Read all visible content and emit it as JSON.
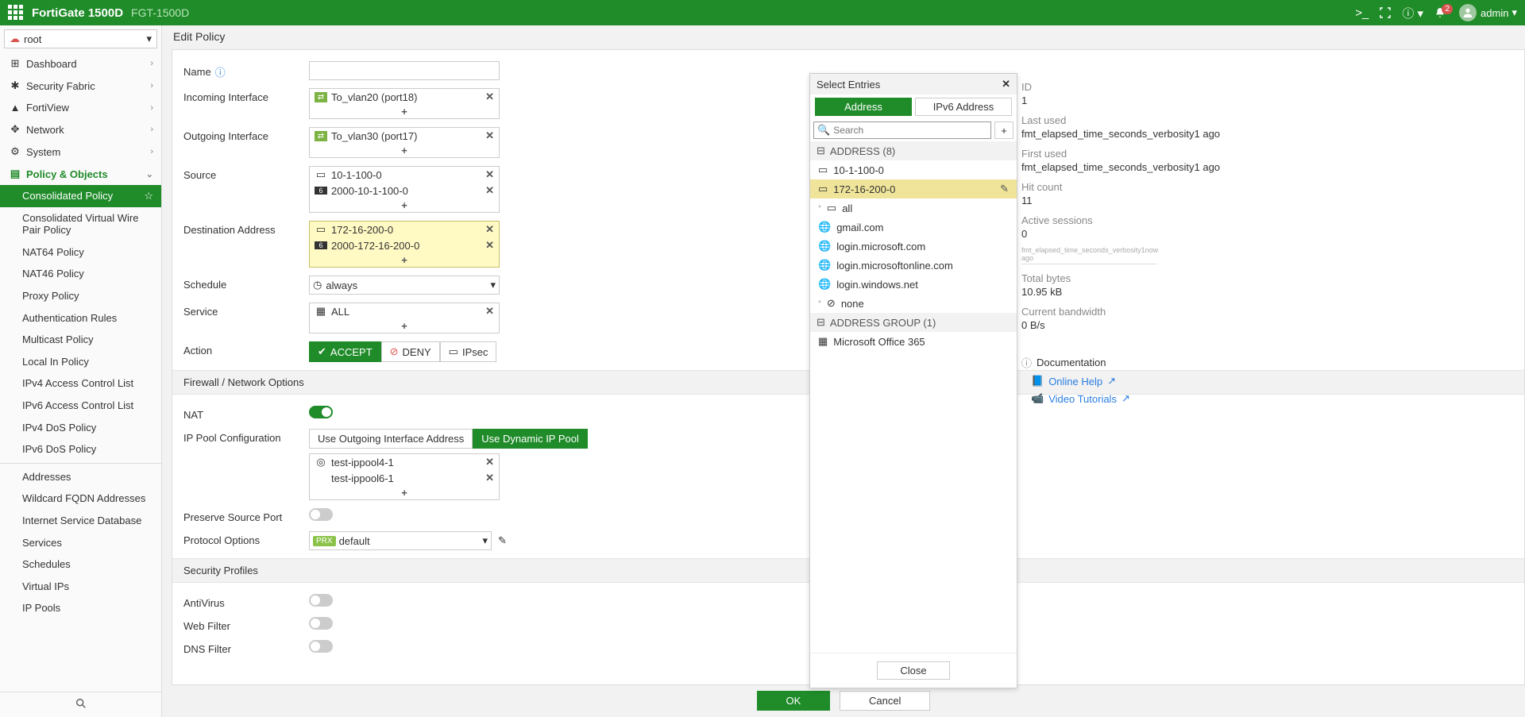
{
  "header": {
    "product": "FortiGate 1500D",
    "model": "FGT-1500D",
    "notification_count": "2",
    "admin": "admin"
  },
  "sidebar": {
    "vdom": "root",
    "items": [
      {
        "icon": "dashboard",
        "label": "Dashboard",
        "arrow": true
      },
      {
        "icon": "security-fabric",
        "label": "Security Fabric",
        "arrow": true
      },
      {
        "icon": "fortiview",
        "label": "FortiView",
        "arrow": true
      },
      {
        "icon": "network",
        "label": "Network",
        "arrow": true
      },
      {
        "icon": "system",
        "label": "System",
        "arrow": true
      },
      {
        "icon": "policy",
        "label": "Policy & Objects",
        "arrow": true,
        "expanded": true
      }
    ],
    "sub_items": [
      {
        "label": "Consolidated Policy",
        "selected": true
      },
      {
        "label": "Consolidated Virtual Wire Pair Policy"
      },
      {
        "label": "NAT64 Policy"
      },
      {
        "label": "NAT46 Policy"
      },
      {
        "label": "Proxy Policy"
      },
      {
        "label": "Authentication Rules"
      },
      {
        "label": "Multicast Policy"
      },
      {
        "label": "Local In Policy"
      },
      {
        "label": "IPv4 Access Control List"
      },
      {
        "label": "IPv6 Access Control List"
      },
      {
        "label": "IPv4 DoS Policy"
      },
      {
        "label": "IPv6 DoS Policy"
      },
      {
        "divider": true
      },
      {
        "label": "Addresses"
      },
      {
        "label": "Wildcard FQDN Addresses"
      },
      {
        "label": "Internet Service Database"
      },
      {
        "label": "Services"
      },
      {
        "label": "Schedules"
      },
      {
        "label": "Virtual IPs"
      },
      {
        "label": "IP Pools"
      }
    ]
  },
  "page": {
    "title": "Edit Policy",
    "form": {
      "name_label": "Name",
      "name_value": "",
      "incoming_label": "Incoming Interface",
      "incoming_value": "To_vlan20 (port18)",
      "outgoing_label": "Outgoing Interface",
      "outgoing_value": "To_vlan30 (port17)",
      "source_label": "Source",
      "source_values": [
        "10-1-100-0",
        "2000-10-1-100-0"
      ],
      "dest_label": "Destination Address",
      "dest_values": [
        "172-16-200-0",
        "2000-172-16-200-0"
      ],
      "schedule_label": "Schedule",
      "schedule_value": "always",
      "service_label": "Service",
      "service_value": "ALL",
      "action_label": "Action",
      "action_accept": "ACCEPT",
      "action_deny": "DENY",
      "action_ipsec": "IPsec"
    },
    "firewall_section": "Firewall / Network Options",
    "nat_label": "NAT",
    "ippool_label": "IP Pool Configuration",
    "ippool_outgoing": "Use Outgoing Interface Address",
    "ippool_dynamic": "Use Dynamic IP Pool",
    "ippool_values": [
      "test-ippool4-1",
      "test-ippool6-1"
    ],
    "preserve_label": "Preserve Source Port",
    "protocol_label": "Protocol Options",
    "protocol_tag": "PRX",
    "protocol_value": "default",
    "security_section": "Security Profiles",
    "antivirus_label": "AntiVirus",
    "webfilter_label": "Web Filter",
    "dnsfilter_label": "DNS Filter",
    "ok_button": "OK",
    "cancel_button": "Cancel"
  },
  "popup": {
    "title": "Select Entries",
    "tab_address": "Address",
    "tab_ipv6": "IPv6 Address",
    "search_placeholder": "Search",
    "group1": "ADDRESS (8)",
    "entries": [
      {
        "label": "10-1-100-0",
        "icon": "addr"
      },
      {
        "label": "172-16-200-0",
        "icon": "addr",
        "selected": true,
        "editable": true
      },
      {
        "label": "all",
        "icon": "addr",
        "wildcard": true
      },
      {
        "label": "gmail.com",
        "icon": "globe"
      },
      {
        "label": "login.microsoft.com",
        "icon": "globe"
      },
      {
        "label": "login.microsoftonline.com",
        "icon": "globe"
      },
      {
        "label": "login.windows.net",
        "icon": "globe"
      },
      {
        "label": "none",
        "icon": "none",
        "wildcard": true
      }
    ],
    "group2": "ADDRESS GROUP (1)",
    "group_entries": [
      {
        "label": "Microsoft Office 365",
        "icon": "group"
      }
    ],
    "close_btn": "Close"
  },
  "info": {
    "id_label": "ID",
    "id_value": "1",
    "lastused_label": "Last used",
    "lastused_value": "fmt_elapsed_time_seconds_verbosity1 ago",
    "firstused_label": "First used",
    "firstused_value": "fmt_elapsed_time_seconds_verbosity1 ago",
    "hit_label": "Hit count",
    "hit_value": "11",
    "sessions_label": "Active sessions",
    "sessions_value": "0",
    "spark_left": "fmt_elapsed_time_seconds_verbosity1 ago",
    "spark_right": "now",
    "bytes_label": "Total bytes",
    "bytes_value": "10.95 kB",
    "bandwidth_label": "Current bandwidth",
    "bandwidth_value": "0 B/s",
    "doc_label": "Documentation",
    "online_help": "Online Help",
    "video": "Video Tutorials"
  }
}
